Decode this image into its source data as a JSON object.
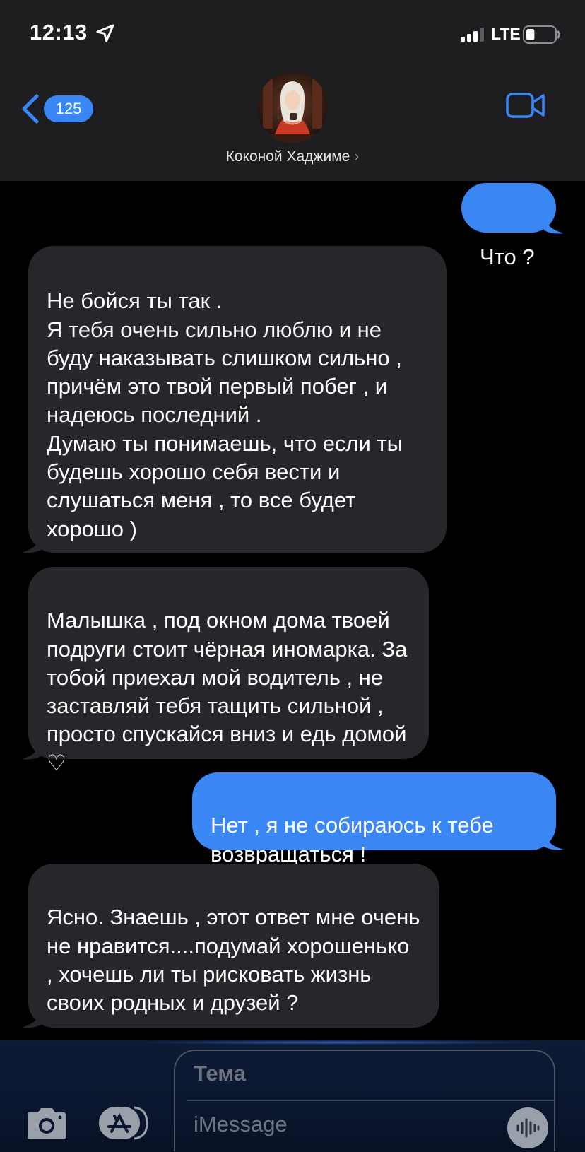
{
  "status_bar": {
    "time": "12:13",
    "network": "LTE",
    "battery_level": 0.15
  },
  "header": {
    "back_badge": "125",
    "contact_name": "Коконой Хаджиме",
    "chevron": "›"
  },
  "messages": [
    {
      "direction": "sent",
      "text": "Что ?"
    },
    {
      "direction": "received",
      "text": "Не бойся ты так .\nЯ тебя очень сильно люблю и не буду наказывать слишком сильно , причём это твой первый побег , и надеюсь последний .\nДумаю ты понимаешь, что если ты будешь хорошо себя вести и слушаться меня , то все будет хорошо )"
    },
    {
      "direction": "received",
      "text": "Малышка , под окном дома твоей подруги стоит чёрная иномарка. За тобой приехал мой водитель , не заставляй тебя тащить сильной , просто спускайся вниз и едь домой ♡"
    },
    {
      "direction": "sent",
      "text": "Нет , я не собираюсь к тебе возвращаться !"
    },
    {
      "direction": "received",
      "text": "Ясно. Знаешь , этот ответ мне очень не нравится....подумай хорошенько , хочешь ли ты рисковать жизнь своих родных и друзей ?"
    }
  ],
  "composer": {
    "subject_placeholder": "Тема",
    "message_placeholder": "iMessage"
  },
  "colors": {
    "sent_bubble": "#3a86f5",
    "received_bubble": "#27272b",
    "accent": "#3a86f5"
  },
  "icons": {
    "back": "chevron-left-icon",
    "video": "video-camera-icon",
    "camera": "camera-icon",
    "app_store": "app-store-icon",
    "audio": "waveform-icon",
    "location": "location-arrow-icon",
    "signal": "cellular-signal-icon",
    "battery": "battery-icon"
  }
}
